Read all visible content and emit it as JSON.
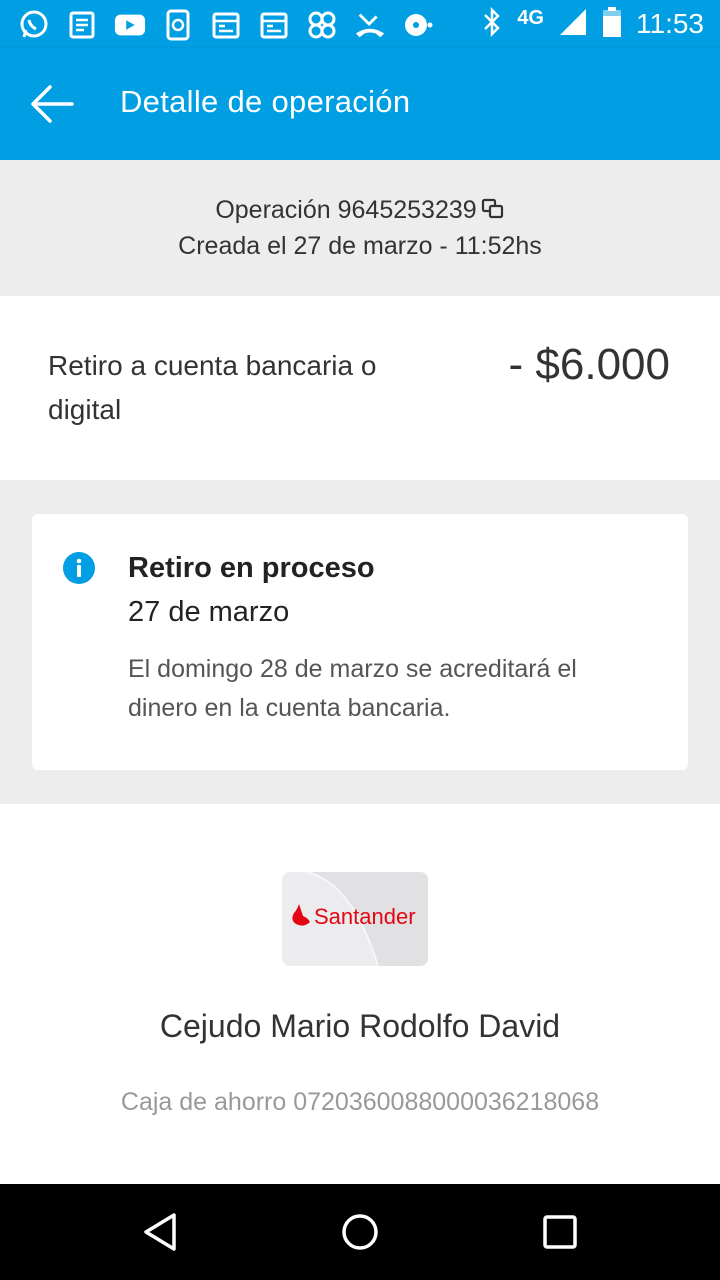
{
  "status_bar": {
    "network": "4G",
    "time": "11:53",
    "icons": [
      "whatsapp-icon",
      "news-icon",
      "youtube-icon",
      "phone-sync-icon",
      "calendar-icon",
      "calendar-icon",
      "pinwheel-icon",
      "missed-call-icon",
      "disc-icon",
      "bluetooth-icon",
      "signal-icon",
      "battery-icon"
    ]
  },
  "app_bar": {
    "title": "Detalle de operación"
  },
  "operation": {
    "number_text": "Operación 9645253239",
    "created_text": "Creada el 27 de marzo - 11:52hs"
  },
  "summary": {
    "description": "Retiro a cuenta bancaria o digital",
    "amount": "- $6.000"
  },
  "status_card": {
    "title": "Retiro en proceso",
    "date": "27 de marzo",
    "message": "El domingo 28 de marzo se acreditará el dinero en la cuenta bancaria."
  },
  "bank": {
    "logo_text": "Santander",
    "holder": "Cejudo Mario Rodolfo David",
    "account": "Caja de ahorro 0720360088000036218068"
  },
  "colors": {
    "brand_blue": "#009ee3",
    "santander_red": "#e30613",
    "info_blue": "#009ee3",
    "section_gray": "#ededed"
  }
}
